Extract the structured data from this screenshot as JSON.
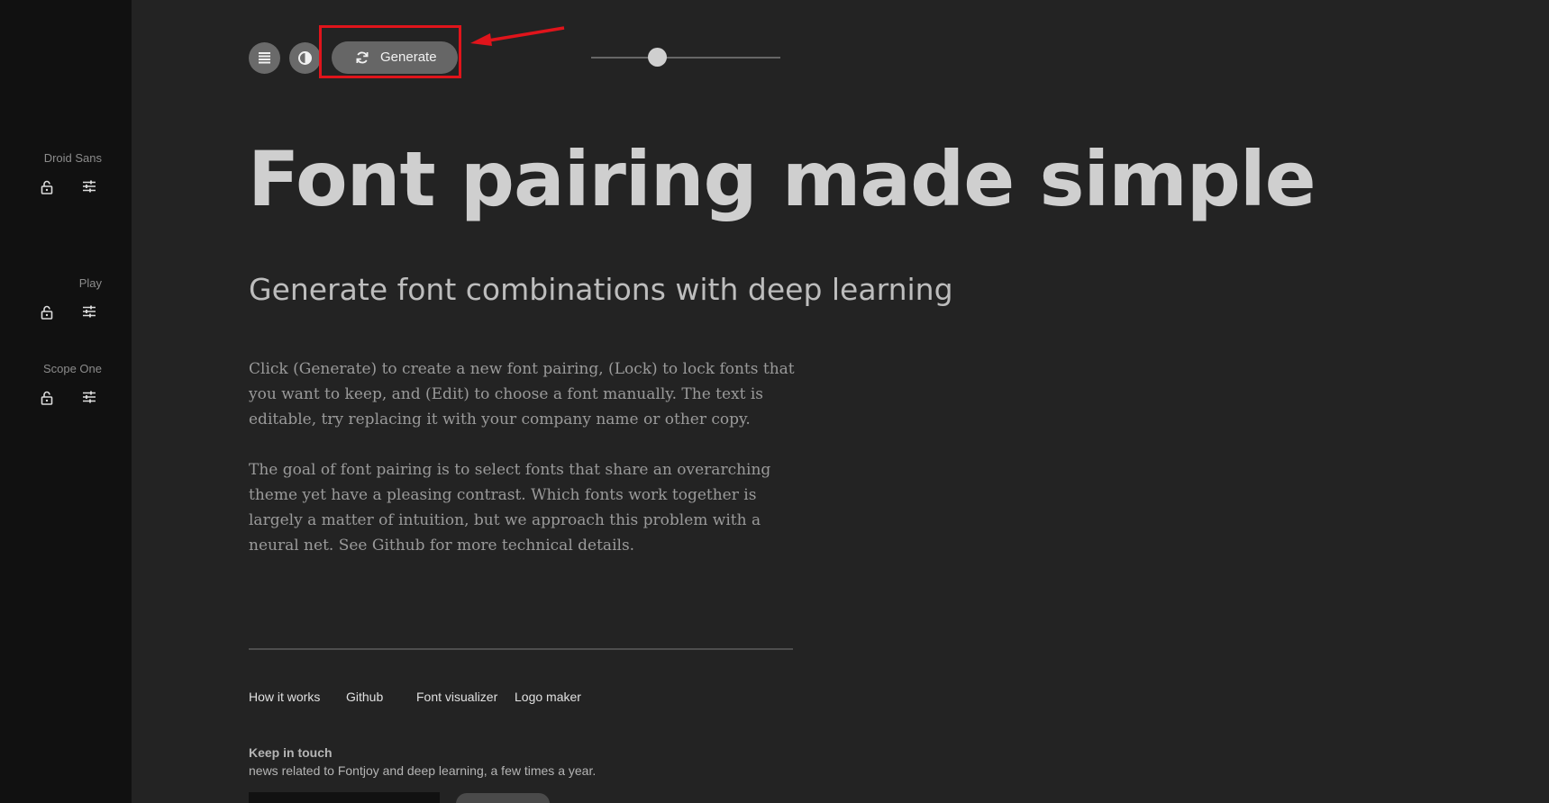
{
  "sidebar": {
    "fonts": [
      {
        "name": "Droid Sans",
        "lock_icon": "lock-icon",
        "edit_icon": "sliders-icon"
      },
      {
        "name": "Play",
        "lock_icon": "lock-icon",
        "edit_icon": "sliders-icon"
      },
      {
        "name": "Scope One",
        "lock_icon": "lock-icon",
        "edit_icon": "sliders-icon"
      }
    ]
  },
  "toolbar": {
    "list_icon": "list-icon",
    "contrast_icon": "contrast-icon",
    "generate_label": "Generate",
    "generate_icon": "refresh-icon",
    "slider_value": 0.35,
    "highlight_color": "#e0141b"
  },
  "main": {
    "headline": "Font pairing made simple",
    "subheading": "Generate font combinations with deep learning",
    "paragraphs": [
      "Click (Generate) to create a new font pairing, (Lock) to lock fonts that you want to keep, and (Edit) to choose a font manually. The text is editable, try replacing it with your company name or other copy.",
      "The goal of font pairing is to select fonts that share an overarching theme yet have a pleasing contrast. Which fonts work together is largely a matter of intuition, but we approach this problem with a neural net. See Github for more technical details."
    ]
  },
  "footer": {
    "links": [
      "How it works",
      "Github",
      "Font visualizer",
      "Logo maker"
    ],
    "keep_title": "Keep in touch",
    "keep_desc": "news related to Fontjoy and deep learning, a few times a year."
  }
}
